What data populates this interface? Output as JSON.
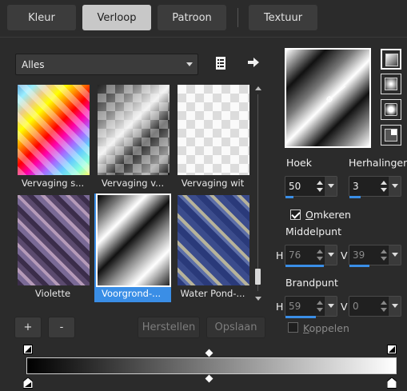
{
  "tabs": [
    {
      "label": "Kleur"
    },
    {
      "label": "Verloop"
    },
    {
      "label": "Patroon"
    },
    {
      "label": "Textuur"
    }
  ],
  "active_tab": "Verloop",
  "category_select": {
    "value": "Alles"
  },
  "gallery": {
    "items": [
      {
        "label": "Vervaging s..."
      },
      {
        "label": "Vervaging v..."
      },
      {
        "label": "Vervaging wit"
      },
      {
        "label": "Violette"
      },
      {
        "label": "Voorgrond-..."
      },
      {
        "label": "Water Pond-..."
      }
    ],
    "selected_index": 4
  },
  "buttons": {
    "add": "+",
    "remove": "-",
    "reset": "Herstellen",
    "save": "Opslaan"
  },
  "angle": {
    "label": "Hoek",
    "value": "50"
  },
  "repeats": {
    "label": "Herhalingen",
    "value": "3"
  },
  "invert": {
    "label": "Omkeren",
    "checked": true
  },
  "center": {
    "label": "Middelpunt",
    "h_label": "H",
    "h_value": "76",
    "v_label": "V",
    "v_value": "39"
  },
  "focal": {
    "label": "Brandpunt",
    "h_label": "H",
    "h_value": "59",
    "v_label": "V",
    "v_value": "0"
  },
  "link": {
    "label": "Koppelen",
    "checked": false
  },
  "colors": {
    "accent": "#3a8ee6",
    "panel": "#2b2b2b"
  }
}
